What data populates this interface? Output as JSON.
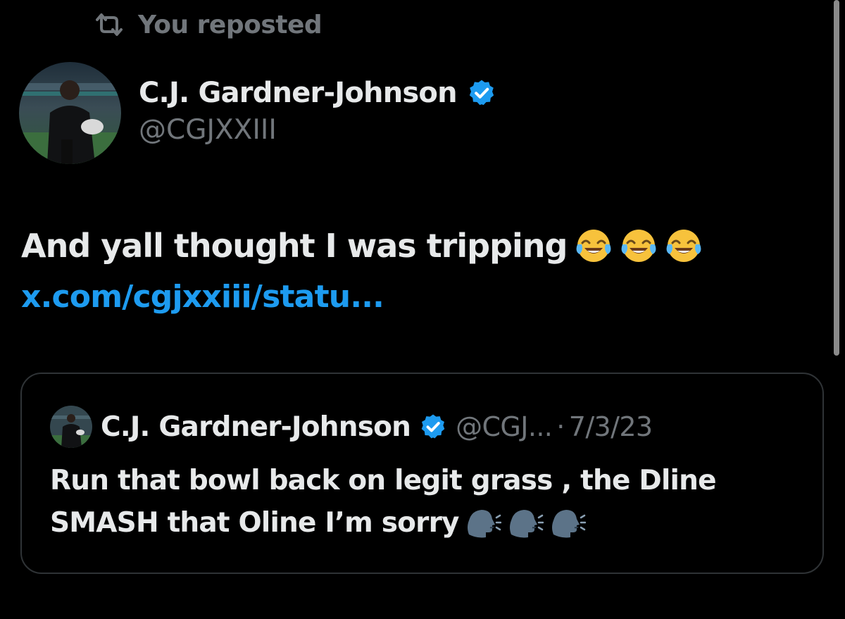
{
  "repost": {
    "label": "You reposted",
    "icon": "repost-icon"
  },
  "tweet": {
    "author": {
      "name": "C.J. Gardner-Johnson",
      "handle": "@CGJXXIII",
      "verified": true,
      "verified_color": "#1d9bf0"
    },
    "text": "And yall thought I was tripping",
    "emojis": [
      "face-with-tears-of-joy",
      "face-with-tears-of-joy",
      "face-with-tears-of-joy"
    ],
    "link": "x.com/cgjxxiii/statu..."
  },
  "quote": {
    "author": {
      "name": "C.J. Gardner-Johnson",
      "handle": "@CGJ...",
      "verified": true
    },
    "separator": "·",
    "date": "7/3/23",
    "text": "Run that bowl back on legit grass , the Dline SMASH that Oline I’m sorry",
    "emojis": [
      "speaking-head",
      "speaking-head",
      "speaking-head"
    ]
  },
  "colors": {
    "background": "#000000",
    "primary_text": "#e7e9ea",
    "secondary_text": "#71767b",
    "link": "#1d9bf0",
    "border": "#2f3336"
  }
}
